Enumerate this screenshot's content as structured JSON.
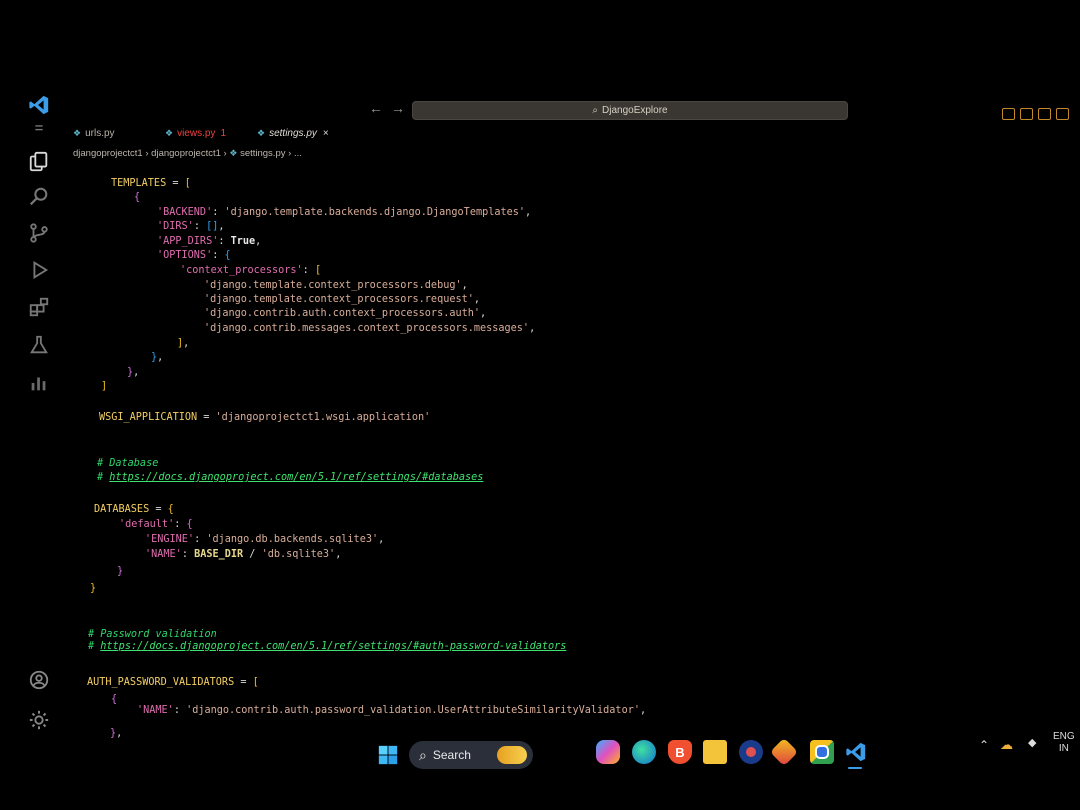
{
  "titlebar": {
    "search_text": "DjangoExplore",
    "back_arrow": "←",
    "forward_arrow": "→"
  },
  "tabs": [
    {
      "label": "urls.py",
      "color": "#b8b0a6"
    },
    {
      "label": "views.py",
      "badge": "1",
      "color": "#f04040"
    },
    {
      "label": "settings.py",
      "close": "×",
      "color": "#e0dcd4"
    }
  ],
  "breadcrumb": {
    "p1": "djangoprojectct1",
    "p2": "djangoprojectct1",
    "file": "settings.py",
    "more": "...",
    "sep": "›"
  },
  "code": {
    "l1_var": "TEMPLATES",
    "l1_rest": " = ",
    "backend_key": "'BACKEND'",
    "backend_val": "'django.template.backends.django.DjangoTemplates'",
    "dirs_key": "'DIRS'",
    "dirs_val": "[]",
    "appdirs_key": "'APP_DIRS'",
    "appdirs_val": "True",
    "options_key": "'OPTIONS'",
    "cp_key": "'context_processors'",
    "cp1": "'django.template.context_processors.debug'",
    "cp2": "'django.template.context_processors.request'",
    "cp3": "'django.contrib.auth.context_processors.auth'",
    "cp4": "'django.contrib.messages.context_processors.messages'",
    "wsgi_var": "WSGI_APPLICATION",
    "wsgi_val": "'djangoprojectct1.wsgi.application'",
    "db_comment": "# Database",
    "db_link_hash": "# ",
    "db_link": "https://docs.djangoproject.com/en/5.1/ref/settings/#databases",
    "db_var": "DATABASES",
    "default_key": "'default'",
    "engine_key": "'ENGINE'",
    "engine_val": "'django.db.backends.sqlite3'",
    "name_key": "'NAME'",
    "name_val1": "BASE_DIR",
    "name_op": " / ",
    "name_val2": "'db.sqlite3'",
    "pw_comment": "# Password validation",
    "pw_link_hash": "# ",
    "pw_link": "https://docs.djangoproject.com/en/5.1/ref/settings/#auth-password-validators",
    "apv_var": "AUTH_PASSWORD_VALIDATORS",
    "apv_name_key": "'NAME'",
    "apv_name_val": "'django.contrib.auth.password_validation.UserAttributeSimilarityValidator'"
  },
  "taskbar": {
    "search_label": "Search",
    "lang_line1": "ENG",
    "lang_line2": "IN"
  },
  "colors": {
    "vscode_blue": "#3b9de8",
    "accent_orange": "#c48a2a"
  }
}
